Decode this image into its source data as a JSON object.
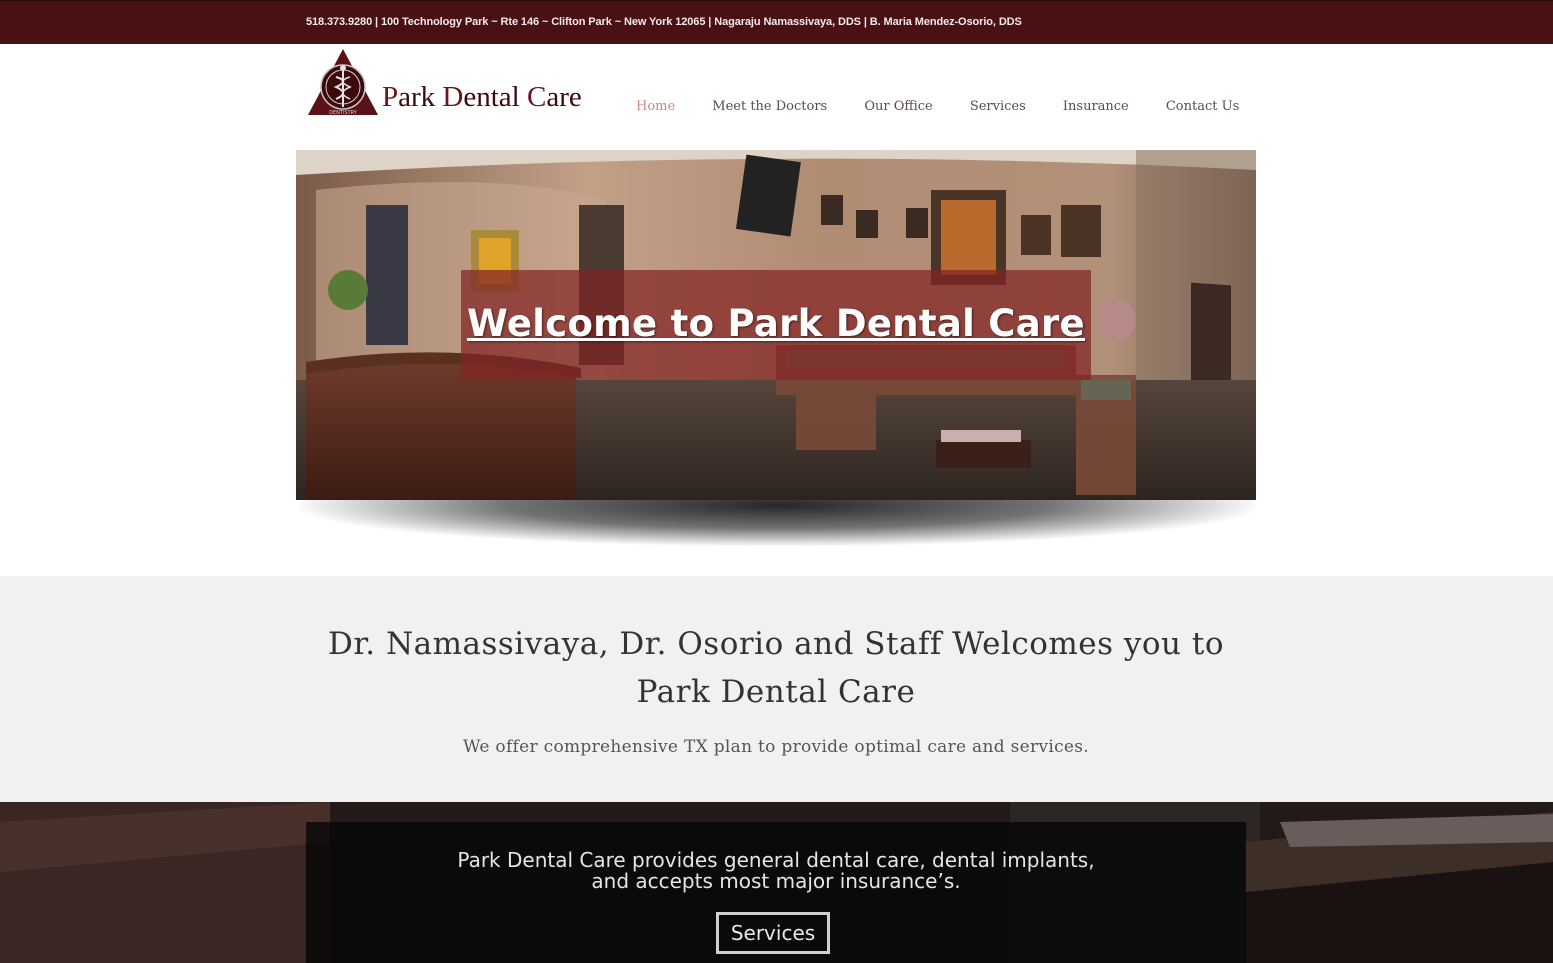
{
  "topbar": {
    "text": "518.373.9280 | 100 Technology Park ~ Rte 146 ~ Clifton Park ~ New York 12065 | Nagaraju Namassivaya, DDS | B. Maria Mendez-Osorio, DDS"
  },
  "logo": {
    "word1_cap": "P",
    "word1_rest": "ark ",
    "word2_cap": "D",
    "word2_rest": "ental ",
    "word3_cap": "C",
    "word3_rest": "are",
    "emblem_text": "DENTISTRY",
    "emblem_icon": "caduceus-icon"
  },
  "nav": {
    "items": [
      {
        "label": "Home"
      },
      {
        "label": "Meet the Doctors"
      },
      {
        "label": "Our Office"
      },
      {
        "label": "Services"
      },
      {
        "label": "Insurance"
      },
      {
        "label": "Contact Us"
      }
    ],
    "active_color": "#d98480"
  },
  "hero": {
    "title": "Welcome to Park Dental Care"
  },
  "welcome": {
    "title_line1": "Dr. Namassivaya, Dr. Osorio and Staff Welcomes you to",
    "title_line2": "Park Dental Care",
    "subtitle": "We offer comprehensive TX plan to provide optimal care and services."
  },
  "band": {
    "line1": "Park Dental Care provides general dental care, dental implants,",
    "line2": "and accepts most major insurance’s.",
    "button_label": "Services"
  },
  "colors": {
    "brand": "#4a1114",
    "caption_overlay": "#822424"
  }
}
